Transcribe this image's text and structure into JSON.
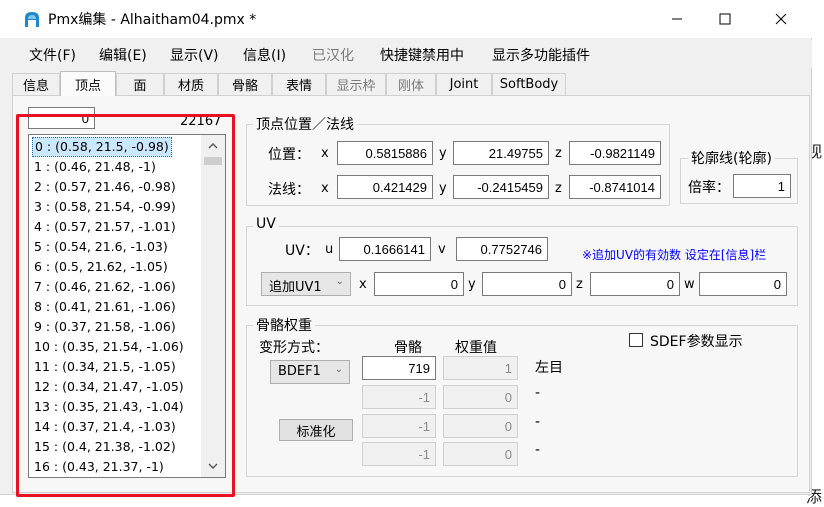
{
  "window": {
    "title": "Pmx编集 - Alhaitham04.pmx *",
    "controls": {
      "minimize": "minimize",
      "maximize": "maximize",
      "close": "close"
    }
  },
  "menu": [
    {
      "label": "文件(F)",
      "enabled": true
    },
    {
      "label": "编辑(E)",
      "enabled": true
    },
    {
      "label": "显示(V)",
      "enabled": true
    },
    {
      "label": "信息(I)",
      "enabled": true
    },
    {
      "label": "已汉化",
      "enabled": false
    },
    {
      "label": "快捷键禁用中",
      "enabled": true
    },
    {
      "label": "显示多功能插件",
      "enabled": true
    }
  ],
  "tabs": [
    {
      "label": "信息",
      "active": false,
      "enabled": true
    },
    {
      "label": "顶点",
      "active": true,
      "enabled": true
    },
    {
      "label": "面",
      "active": false,
      "enabled": true
    },
    {
      "label": "材质",
      "active": false,
      "enabled": true
    },
    {
      "label": "骨骼",
      "active": false,
      "enabled": true
    },
    {
      "label": "表情",
      "active": false,
      "enabled": true
    },
    {
      "label": "显示枠",
      "active": false,
      "enabled": false
    },
    {
      "label": "刚体",
      "active": false,
      "enabled": false
    },
    {
      "label": "Joint",
      "active": false,
      "enabled": true
    },
    {
      "label": "SoftBody",
      "active": false,
      "enabled": true
    }
  ],
  "vertex_list": {
    "index_input": "0",
    "count": "22167",
    "selected_index": 0,
    "items": [
      "0 : (0.58, 21.5, -0.98)",
      "1 : (0.46, 21.48, -1)",
      "2 : (0.57, 21.46, -0.98)",
      "3 : (0.58, 21.54, -0.99)",
      "4 : (0.57, 21.57, -1.01)",
      "5 : (0.54, 21.6, -1.03)",
      "6 : (0.5, 21.62, -1.05)",
      "7 : (0.46, 21.62, -1.06)",
      "8 : (0.41, 21.61, -1.06)",
      "9 : (0.37, 21.58, -1.06)",
      "10 : (0.35, 21.54, -1.06)",
      "11 : (0.34, 21.5, -1.05)",
      "12 : (0.34, 21.47, -1.05)",
      "13 : (0.35, 21.43, -1.04)",
      "14 : (0.37, 21.4, -1.03)",
      "15 : (0.4, 21.38, -1.02)",
      "16 : (0.43, 21.37, -1)"
    ]
  },
  "position_normal": {
    "title": "顶点位置／法线",
    "position_label": "位置：",
    "normal_label": "法线：",
    "axis_x": "x",
    "axis_y": "y",
    "axis_z": "z",
    "position": {
      "x": "0.5815886",
      "y": "21.49755",
      "z": "-0.9821149"
    },
    "normal": {
      "x": "0.421429",
      "y": "-0.2415459",
      "z": "-0.8741014"
    }
  },
  "outline": {
    "title": "轮廓线(轮廓)",
    "rate_label": "倍率：",
    "rate_value": "1"
  },
  "uv": {
    "title": "UV",
    "uv_label": "UV：",
    "u_label": "u",
    "v_label": "v",
    "u_value": "0.1666141",
    "v_value": "0.7752746",
    "hint": "※追加UV的有効数 设定在[信息]栏",
    "add_uv_select": "追加UV1",
    "add_x_label": "x",
    "add_y_label": "y",
    "add_z_label": "z",
    "add_w_label": "w",
    "add_x": "0",
    "add_y": "0",
    "add_z": "0",
    "add_w": "0"
  },
  "bone_weight": {
    "title": "骨骼权重",
    "deform_label": "变形方式：",
    "deform_select": "BDEF1",
    "bone_header": "骨骼",
    "weight_header": "权重值",
    "normalize_button": "标准化",
    "sdef_checkbox_label": "SDEF参数显示",
    "rows": [
      {
        "bone": "719",
        "weight": "1",
        "name": "左目",
        "enabled": true
      },
      {
        "bone": "-1",
        "weight": "0",
        "name": "-",
        "enabled": false
      },
      {
        "bone": "-1",
        "weight": "0",
        "name": "-",
        "enabled": false
      },
      {
        "bone": "-1",
        "weight": "0",
        "name": "-",
        "enabled": false
      }
    ]
  },
  "background_peek": {
    "right_glyph_1": "视",
    "right_glyph_2": "添"
  },
  "colors": {
    "selection_bg": "#cce8ff",
    "highlight_border": "#e81123",
    "hint_text": "#0000ff",
    "app_icon": "#1e88c8"
  }
}
